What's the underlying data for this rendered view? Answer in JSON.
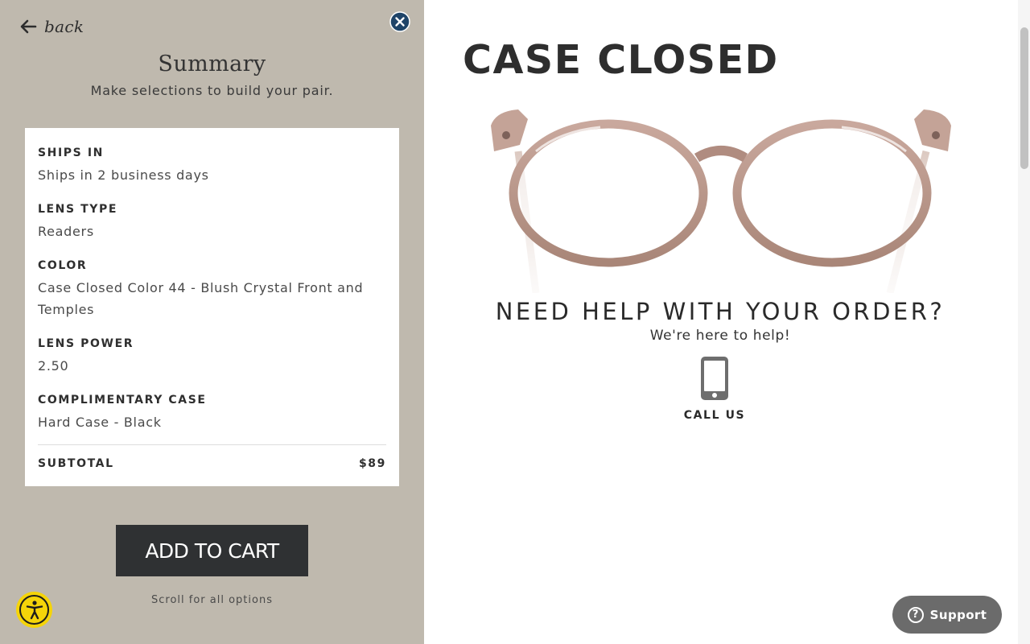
{
  "panel": {
    "back_label": "back",
    "title": "Summary",
    "subtitle": "Make selections to build your pair.",
    "background_color": "#bfb9ae",
    "close_icon": "close-circle-icon"
  },
  "summary": {
    "rows": [
      {
        "label": "SHIPS IN",
        "value": "Ships in 2 business days"
      },
      {
        "label": "LENS TYPE",
        "value": "Readers"
      },
      {
        "label": "COLOR",
        "value": "Case Closed Color 44 - Blush Crystal Front and Temples"
      },
      {
        "label": "LENS POWER",
        "value": "2.50"
      },
      {
        "label": "COMPLIMENTARY CASE",
        "value": "Hard Case - Black"
      }
    ],
    "subtotal_label": "SUBTOTAL",
    "subtotal_value": "$89"
  },
  "actions": {
    "add_to_cart_label": "ADD TO CART",
    "scroll_hint": "Scroll for all options",
    "button_color": "#2f3133"
  },
  "product": {
    "title": "CASE CLOSED",
    "image_alt": "Blush crystal round eyeglasses"
  },
  "help": {
    "heading": "NEED HELP WITH YOUR ORDER?",
    "subtext": "We're here to help!",
    "call_label": "CALL US",
    "call_icon": "phone-icon"
  },
  "widgets": {
    "support_label": "Support",
    "support_icon": "question-circle-icon",
    "accessibility_icon": "accessibility-icon",
    "accessibility_color": "#f5d409"
  }
}
